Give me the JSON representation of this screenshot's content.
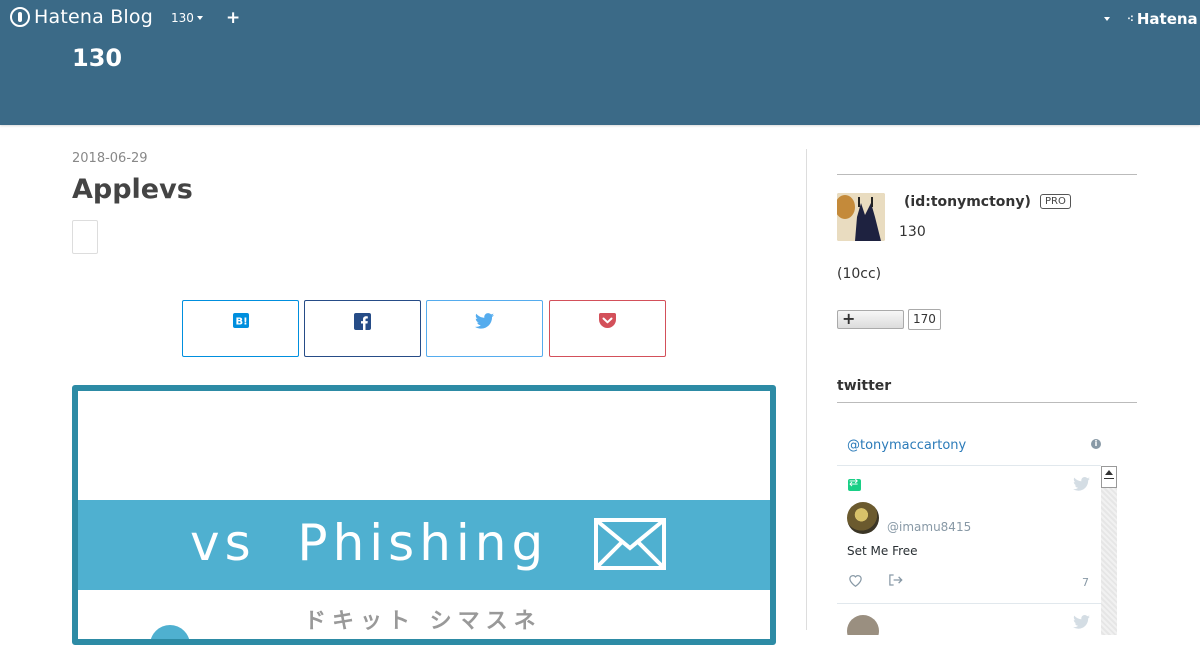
{
  "global_header": {
    "brand": "Hatena Blog",
    "blog_selector": "130",
    "add_symbol": "+",
    "right_brand": "Hatena"
  },
  "blog": {
    "title": "130"
  },
  "entry": {
    "date": "2018-06-29",
    "title": "Applevs"
  },
  "share_buttons": [
    {
      "name": "hatena-bookmark",
      "color": "#008fde"
    },
    {
      "name": "facebook",
      "color": "#264c87"
    },
    {
      "name": "twitter",
      "color": "#55acee"
    },
    {
      "name": "pocket",
      "color": "#d3505a"
    }
  ],
  "eyecatch": {
    "headline": "vs  Phishing",
    "subtext": "ドキット シマスネ",
    "band_color": "#4fb0d0",
    "frame_color": "#2d8ba5"
  },
  "profile": {
    "id_label": "(id:tonymctony)",
    "badge": "PRO",
    "blog_name": "130",
    "note": "(10cc)",
    "subscribe_symbol": "+",
    "subscribe_count": "170"
  },
  "twitter_module": {
    "title": "twitter",
    "handle": "@tonymaccartony",
    "tweet": {
      "user": "@imamu8415",
      "text": "Set Me Free",
      "count": "7"
    }
  },
  "colors": {
    "header": "#3b6a87",
    "link": "#2b7bb9"
  }
}
